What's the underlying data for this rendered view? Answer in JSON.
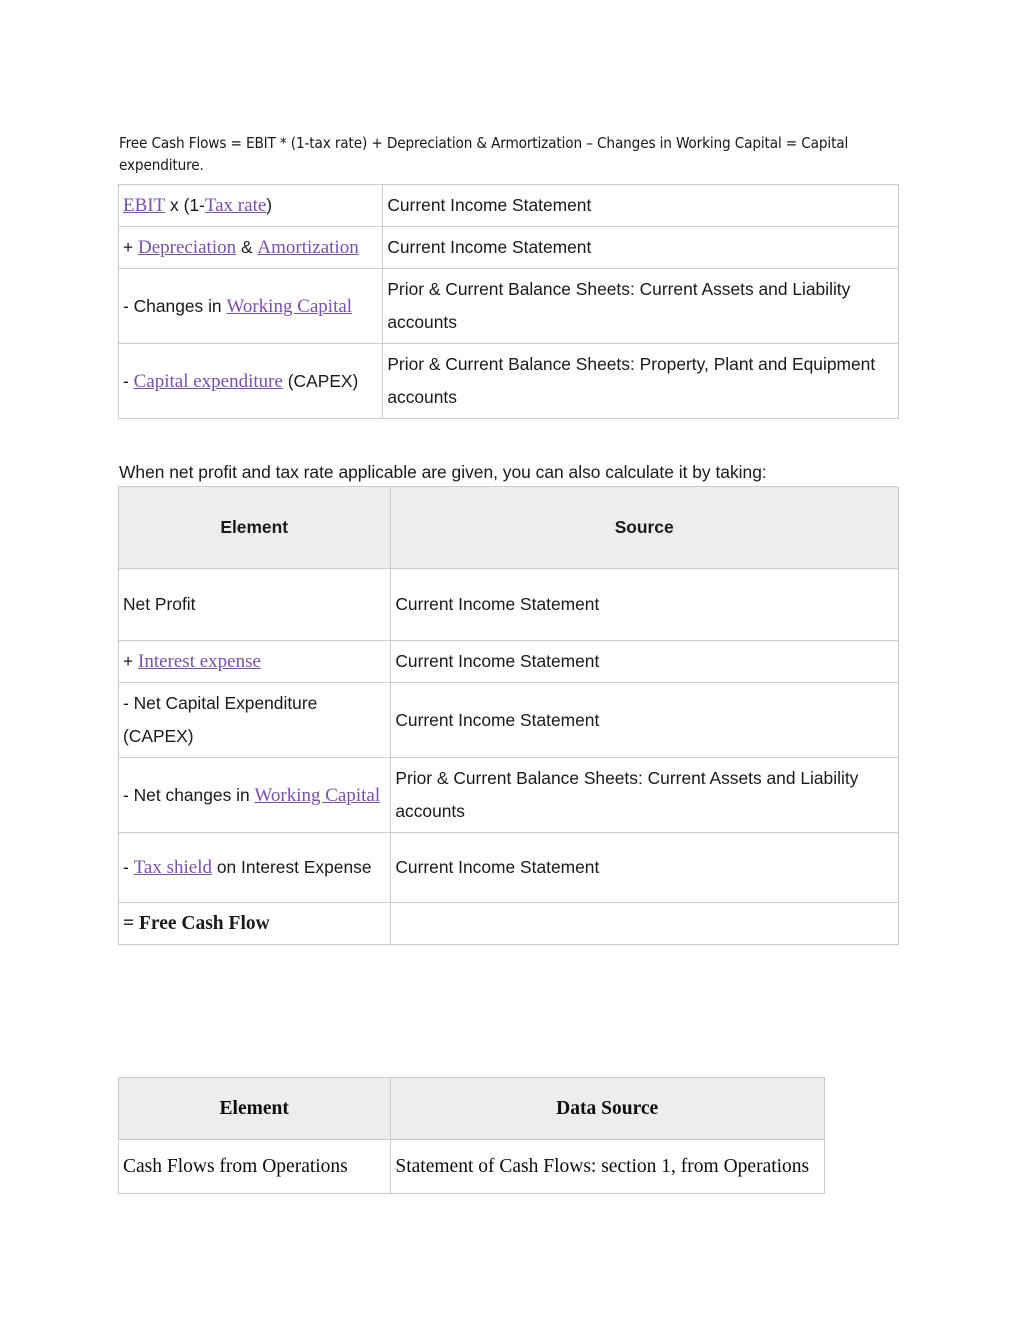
{
  "document": {
    "intro_paragraph": "Free Cash Flows = EBIT * (1-tax rate) + Depreciation & Armortization – Changes in Working Capital = Capital expenditure.",
    "mid_paragraph": "When net profit and tax rate applicable are given, you can also calculate it by taking:"
  },
  "colors": {
    "link": "#7b50a8",
    "header_background": "#ededed",
    "border": "#cbcbcb",
    "text": "#1a1a1a",
    "page_background": "#ffffff"
  },
  "table_fcf_ebit": {
    "rows": [
      {
        "element": {
          "parts": [
            {
              "text": "EBIT",
              "link": true
            },
            {
              "text": " x (1-",
              "link": false
            },
            {
              "text": "Tax rate",
              "link": true
            },
            {
              "text": ")",
              "link": false
            }
          ]
        },
        "source": "Current Income Statement"
      },
      {
        "element": {
          "parts": [
            {
              "text": "+ ",
              "link": false
            },
            {
              "text": "Depreciation",
              "link": true
            },
            {
              "text": " & ",
              "link": false
            },
            {
              "text": "Amortization",
              "link": true
            }
          ]
        },
        "source": "Current Income Statement"
      },
      {
        "element": {
          "parts": [
            {
              "text": "- Changes in ",
              "link": false
            },
            {
              "text": "Working Capital",
              "link": true
            }
          ]
        },
        "source": "Prior & Current Balance Sheets: Current Assets and Liability accounts"
      },
      {
        "element": {
          "parts": [
            {
              "text": "- ",
              "link": false
            },
            {
              "text": "Capital expenditure",
              "link": true
            },
            {
              "text": " (CAPEX)",
              "link": false
            }
          ]
        },
        "source": "Prior & Current Balance Sheets: Property, Plant and Equipment accounts"
      }
    ]
  },
  "table_fcf_netprofit": {
    "headers": [
      "Element",
      "Source"
    ],
    "rows": [
      {
        "element": {
          "parts": [
            {
              "text": "Net Profit",
              "link": false
            }
          ]
        },
        "source": "Current Income Statement"
      },
      {
        "element": {
          "parts": [
            {
              "text": "+ ",
              "link": false
            },
            {
              "text": "Interest expense",
              "link": true
            }
          ]
        },
        "source": "Current Income Statement"
      },
      {
        "element": {
          "parts": [
            {
              "text": "- Net Capital Expenditure (CAPEX)",
              "link": false
            }
          ]
        },
        "source": "Current Income Statement"
      },
      {
        "element": {
          "parts": [
            {
              "text": "- Net changes in ",
              "link": false
            },
            {
              "text": "Working Capital",
              "link": true
            }
          ]
        },
        "source": "Prior & Current Balance Sheets: Current Assets and Liability accounts"
      },
      {
        "element": {
          "parts": [
            {
              "text": "- ",
              "link": false
            },
            {
              "text": "Tax shield",
              "link": true
            },
            {
              "text": " on Interest Expense",
              "link": false
            }
          ]
        },
        "source": "Current Income Statement"
      },
      {
        "element": {
          "parts": [
            {
              "text": "= Free Cash Flow",
              "link": false,
              "bold_serif": true
            }
          ]
        },
        "source": ""
      }
    ]
  },
  "table_fcf_ops": {
    "headers": [
      "Element",
      "Data Source"
    ],
    "rows": [
      {
        "element": {
          "parts": [
            {
              "text": "Cash Flows from Operations",
              "link": false
            }
          ]
        },
        "source": "Statement of Cash Flows: section 1, from Operations"
      }
    ]
  }
}
